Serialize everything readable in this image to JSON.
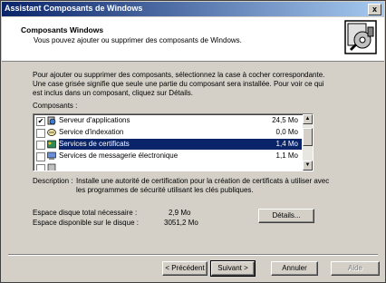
{
  "window": {
    "title": "Assistant Composants de Windows",
    "close_glyph": "x"
  },
  "header": {
    "title": "Composants Windows",
    "subtitle": "Vous pouvez ajouter ou supprimer des composants de Windows."
  },
  "intro": "Pour ajouter ou supprimer des composants, sélectionnez la case à cocher correspondante. Une case grisée signifie que seule une partie du composant sera installée. Pour voir ce qui est inclus dans un composant, cliquez sur Détails.",
  "components_label": "Composants :",
  "components": [
    {
      "name": "Serveur d'applications",
      "size": "24,5 Mo",
      "checked": true,
      "icon": "application-server-icon"
    },
    {
      "name": "Service d'indexation",
      "size": "0,0 Mo",
      "checked": false,
      "icon": "indexing-service-icon"
    },
    {
      "name": "Services de certificats",
      "size": "1,4 Mo",
      "checked": false,
      "selected": true,
      "icon": "certificate-icon"
    },
    {
      "name": "Services de messagerie électronique",
      "size": "1,1 Mo",
      "checked": false,
      "icon": "email-icon"
    }
  ],
  "description_label": "Description :",
  "description": "Installe une autorité de certification pour la création de certificats à utiliser avec les programmes de sécurité utilisant les clés publiques.",
  "disk": {
    "required_label": "Espace disque total nécessaire :",
    "required_value": "2,9 Mo",
    "available_label": "Espace disponible sur le disque :",
    "available_value": "3051,2 Mo"
  },
  "buttons": {
    "details": "Détails...",
    "back": "< Précédent",
    "next": "Suivant >",
    "cancel": "Annuler",
    "help": "Aide"
  },
  "colors": {
    "selection": "#0a246a",
    "title_gradient_start": "#0a246a",
    "title_gradient_end": "#a6caf0"
  }
}
